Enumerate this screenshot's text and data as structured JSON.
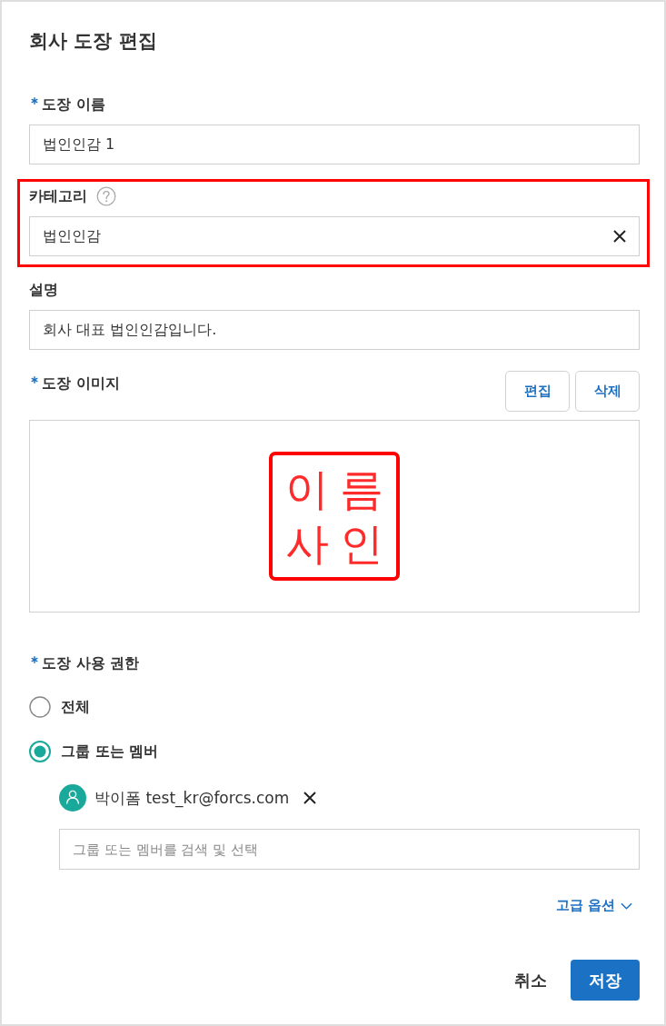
{
  "dialog": {
    "title": "회사 도장 편집"
  },
  "fields": [
    {
      "kind": "text",
      "label": "도장 이름",
      "required": true,
      "value": "법인인감 1",
      "help": false,
      "clearable": false,
      "highlighted": false
    },
    {
      "kind": "select",
      "label": "카테고리",
      "required": false,
      "value": "법인인감",
      "help": true,
      "clearable": true,
      "highlighted": true
    },
    {
      "kind": "text",
      "label": "설명",
      "required": false,
      "value": "회사 대표 법인인감입니다.",
      "help": false,
      "clearable": false,
      "highlighted": false
    }
  ],
  "stamp_image": {
    "label": "도장 이미지",
    "required": true,
    "buttons": [
      "편집",
      "삭제"
    ],
    "stamp_lines": [
      "이름",
      "사인"
    ]
  },
  "permission": {
    "label": "도장 사용 권한",
    "required": true,
    "options": [
      {
        "label": "전체",
        "selected": false
      },
      {
        "label": "그룹 또는 멤버",
        "selected": true
      }
    ],
    "members": [
      {
        "label": "박이폼 test_kr@forcs.com"
      }
    ],
    "search": {
      "placeholder": "그룹 또는 멤버를 검색 및 선택"
    },
    "advanced": "고급 옵션"
  },
  "footer": {
    "buttons": [
      {
        "label": "취소",
        "kind": "secondary"
      },
      {
        "label": "저장",
        "kind": "primary"
      }
    ]
  }
}
